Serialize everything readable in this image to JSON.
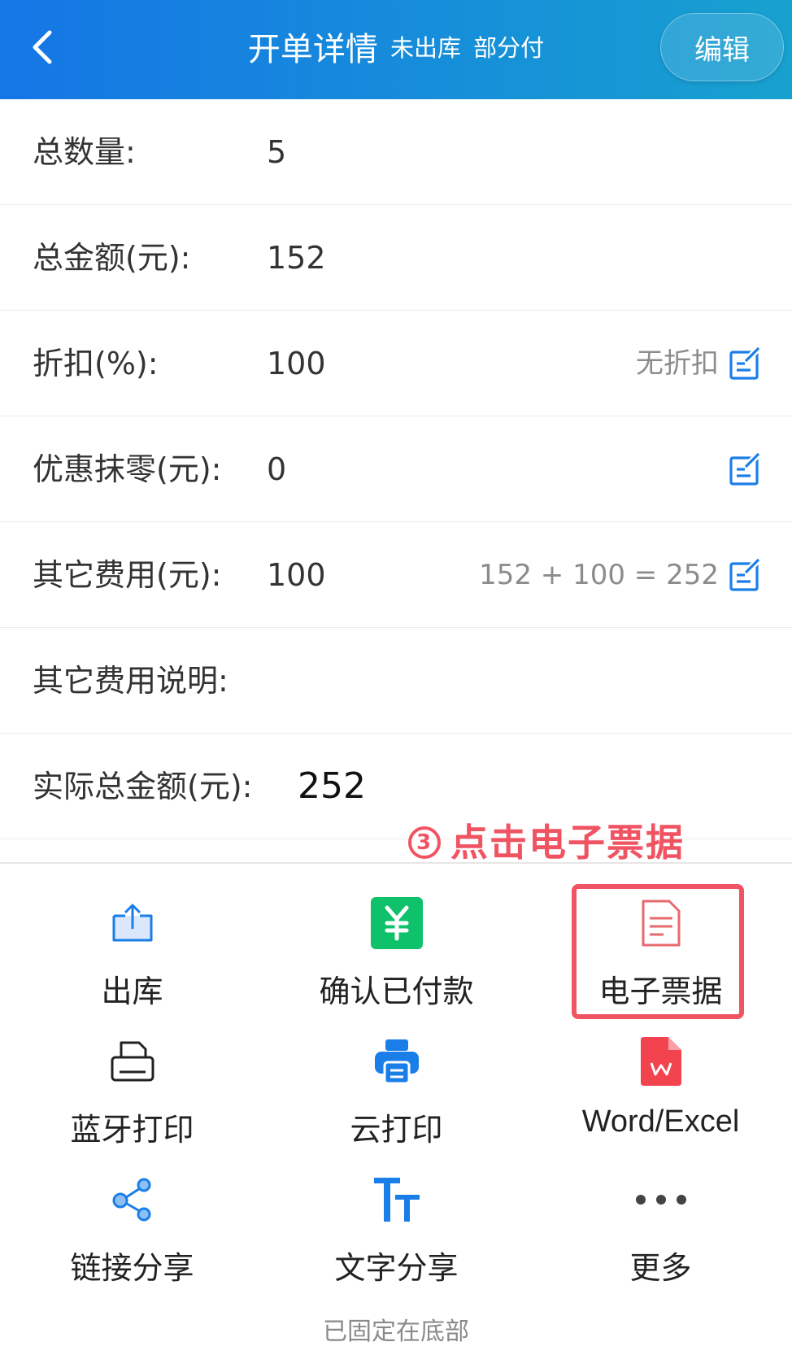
{
  "header": {
    "title": "开单详情",
    "status_stock": "未出库",
    "status_pay": "部分付",
    "edit_label": "编辑",
    "bg_start": "#1576e6",
    "bg_end": "#17a1cf"
  },
  "rows": [
    {
      "label": "总数量:",
      "value": "5"
    },
    {
      "label": "总金额(元):",
      "value": "152"
    },
    {
      "label": "折扣(%):",
      "value": "100",
      "hint": "无折扣"
    },
    {
      "label": "优惠抹零(元):",
      "value": "0"
    },
    {
      "label": "其它费用(元):",
      "value": "100",
      "hint": "152 + 100 = 252"
    },
    {
      "label": "其它费用说明:",
      "value": ""
    },
    {
      "label": "实际总金额(元):",
      "value": "252"
    }
  ],
  "annotation": {
    "number": "3",
    "text": "点击电子票据",
    "color": "#f05462"
  },
  "actions": [
    {
      "label": "出库",
      "icon": "export-icon"
    },
    {
      "label": "确认已付款",
      "icon": "yuan-icon"
    },
    {
      "label": "电子票据",
      "icon": "document-icon"
    },
    {
      "label": "蓝牙打印",
      "icon": "printer-icon"
    },
    {
      "label": "云打印",
      "icon": "cloud-printer-icon"
    },
    {
      "label": "Word/Excel",
      "icon": "wps-file-icon"
    },
    {
      "label": "链接分享",
      "icon": "share-icon"
    },
    {
      "label": "文字分享",
      "icon": "text-icon"
    },
    {
      "label": "更多",
      "icon": "more-icon"
    }
  ],
  "footer": {
    "note": "已固定在底部"
  },
  "colors": {
    "accent_blue": "#1a7ee8",
    "confirm_green": "#0fc16b",
    "document_red": "#e8696d",
    "word_red": "#f2434e"
  }
}
